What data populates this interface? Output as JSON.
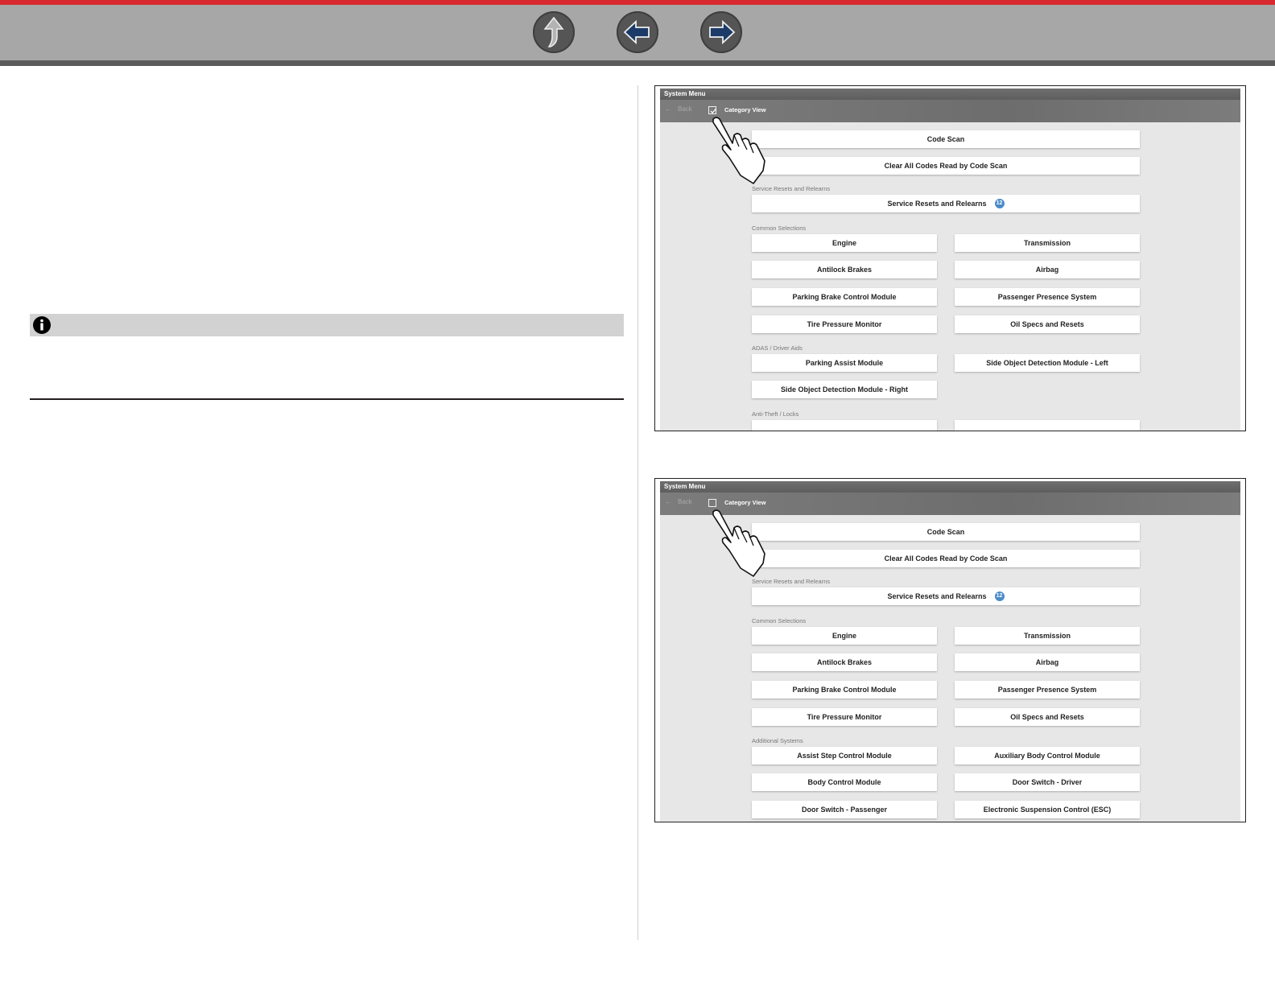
{
  "nav": {
    "colors": {
      "top_stripe": "#d8282f",
      "bar": "#a7a7a7",
      "button": "#555555",
      "arrow_up": "#aaaaaa",
      "arrow_side": "#1c3b68"
    },
    "buttons": [
      {
        "name": "up-arrow-icon"
      },
      {
        "name": "back-arrow-icon"
      },
      {
        "name": "forward-arrow-icon"
      }
    ]
  },
  "note": {
    "icon": "info-icon"
  },
  "figure1": {
    "title": "System Menu",
    "back_label": "Back",
    "category_view_label": "Category View",
    "category_view_checked": true,
    "code_scan": "Code Scan",
    "clear_codes": "Clear All Codes Read by Code Scan",
    "section_service": "Service Resets and Relearns",
    "service_button": "Service Resets and Relearns",
    "service_badge": "12",
    "section_common": "Common Selections",
    "engine": "Engine",
    "transmission": "Transmission",
    "antilock": "Antilock Brakes",
    "airbag": "Airbag",
    "parking_brake": "Parking Brake Control Module",
    "passenger_presence": "Passenger Presence System",
    "tire_pressure": "Tire Pressure Monitor",
    "oil_specs": "Oil Specs and Resets",
    "section_adas": "ADAS / Driver Aids",
    "parking_assist": "Parking Assist Module",
    "side_left": "Side Object Detection Module - Left",
    "side_right": "Side Object Detection Module - Right",
    "section_antitheft": "Anti-Theft / Locks"
  },
  "figure2": {
    "title": "System Menu",
    "back_label": "Back",
    "category_view_label": "Category View",
    "category_view_checked": false,
    "code_scan": "Code Scan",
    "clear_codes": "Clear All Codes Read by Code Scan",
    "section_service": "Service Resets and Relearns",
    "service_button": "Service Resets and Relearns",
    "service_badge": "12",
    "section_common": "Common Selections",
    "engine": "Engine",
    "transmission": "Transmission",
    "antilock": "Antilock Brakes",
    "airbag": "Airbag",
    "parking_brake": "Parking Brake Control Module",
    "passenger_presence": "Passenger Presence System",
    "tire_pressure": "Tire Pressure Monitor",
    "oil_specs": "Oil Specs and Resets",
    "section_additional": "Additional Systems",
    "assist_step": "Assist Step Control Module",
    "aux_body": "Auxiliary Body Control Module",
    "body_control": "Body Control Module",
    "door_driver": "Door Switch - Driver",
    "door_passenger": "Door Switch - Passenger",
    "esc": "Electronic Suspension Control (ESC)"
  }
}
